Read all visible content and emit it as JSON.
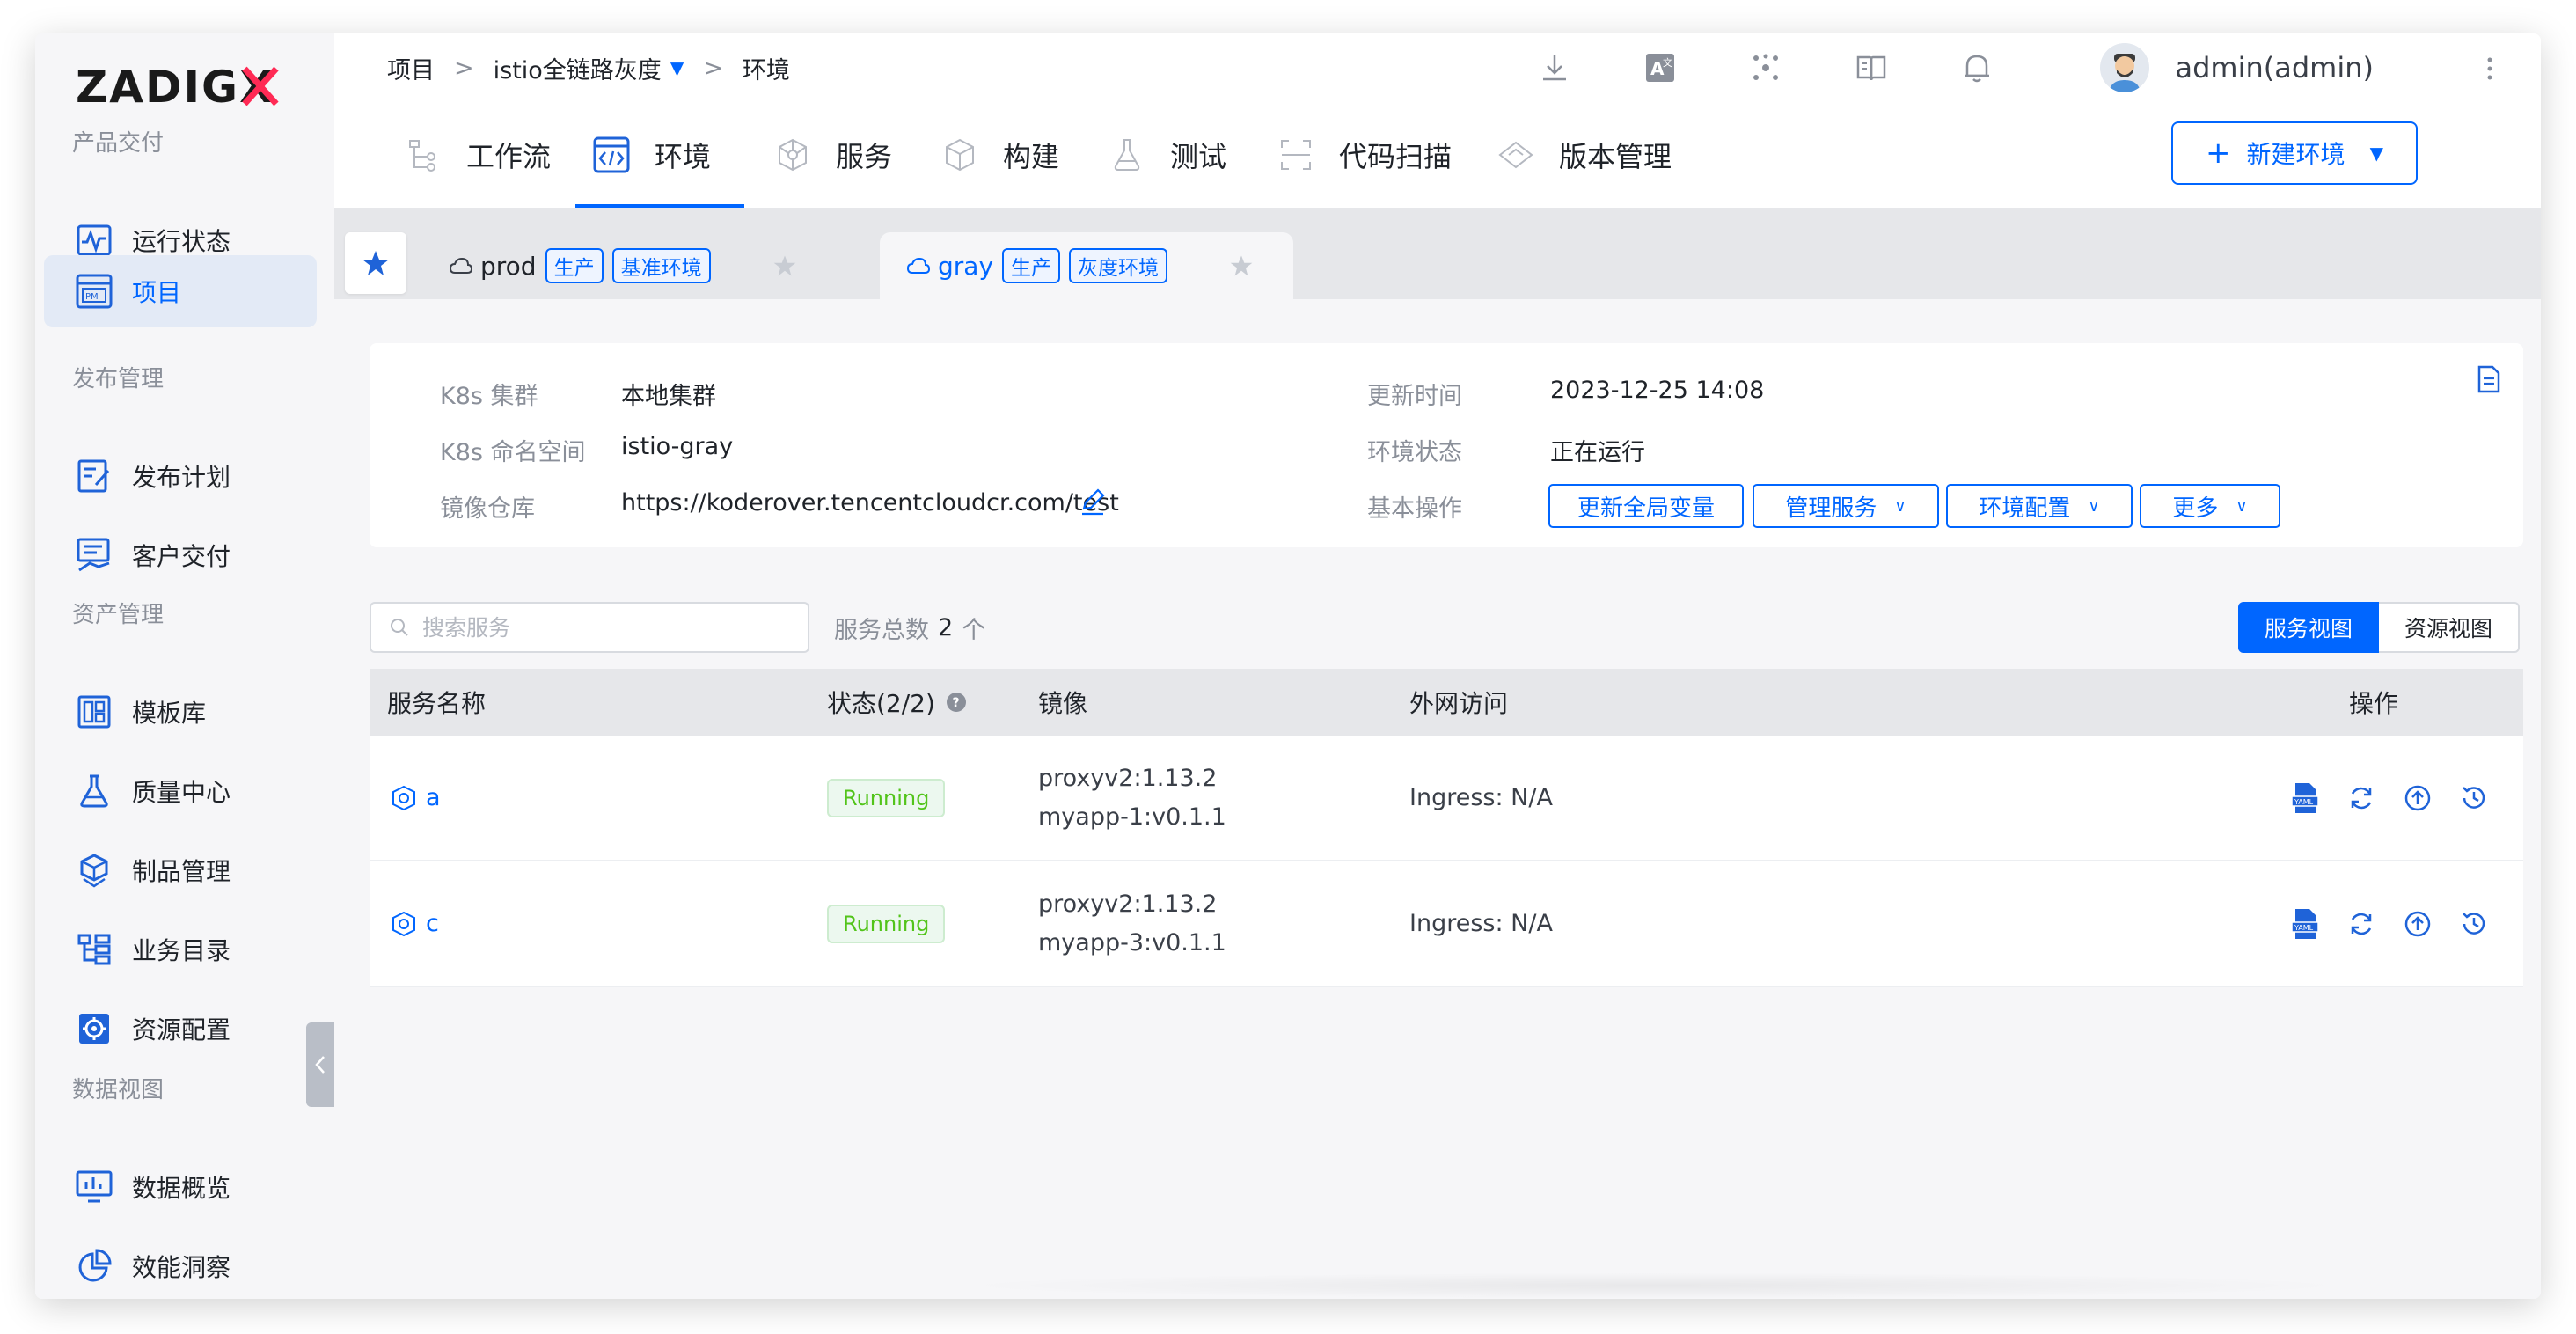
{
  "colors": {
    "accent": "#0066ff",
    "sidebar_bg": "#f6f6f8",
    "running_green": "#52c41a"
  },
  "sidebar": {
    "brand": "ZADIGX",
    "sections": [
      {
        "title": "产品交付",
        "items": [
          {
            "label": "运行状态",
            "icon": "pulse-icon"
          },
          {
            "label": "项目",
            "icon": "project-icon",
            "active": true
          }
        ]
      },
      {
        "title": "发布管理",
        "items": [
          {
            "label": "发布计划",
            "icon": "release-plan-icon"
          },
          {
            "label": "客户交付",
            "icon": "customer-delivery-icon"
          }
        ]
      },
      {
        "title": "资产管理",
        "items": [
          {
            "label": "模板库",
            "icon": "template-icon"
          },
          {
            "label": "质量中心",
            "icon": "flask-icon"
          },
          {
            "label": "制品管理",
            "icon": "artifact-icon"
          },
          {
            "label": "业务目录",
            "icon": "catalog-icon"
          },
          {
            "label": "资源配置",
            "icon": "gear-icon"
          }
        ]
      },
      {
        "title": "数据视图",
        "items": [
          {
            "label": "数据概览",
            "icon": "monitor-chart-icon"
          },
          {
            "label": "效能洞察",
            "icon": "pie-chart-icon"
          }
        ]
      }
    ]
  },
  "header": {
    "breadcrumbs": [
      "项目",
      "istio全链路灰度",
      "环境"
    ],
    "user": "admin(admin)"
  },
  "nav": {
    "items": [
      "工作流",
      "环境",
      "服务",
      "构建",
      "测试",
      "代码扫描",
      "版本管理"
    ],
    "active": "环境",
    "new_env_button": "新建环境"
  },
  "env_tabs": [
    {
      "name": "prod",
      "tags": [
        "生产",
        "基准环境"
      ]
    },
    {
      "name": "gray",
      "tags": [
        "生产",
        "灰度环境"
      ],
      "active": true
    }
  ],
  "env_info": {
    "k8s_cluster_label": "K8s 集群",
    "k8s_cluster": "本地集群",
    "namespace_label": "K8s 命名空间",
    "namespace": "istio-gray",
    "registry_label": "镜像仓库",
    "registry": "https://koderover.tencentcloudcr.com/test",
    "updated_label": "更新时间",
    "updated": "2023-12-25 14:08",
    "status_label": "环境状态",
    "status": "正在运行",
    "ops_label": "基本操作",
    "ops": [
      "更新全局变量",
      "管理服务",
      "环境配置",
      "更多"
    ]
  },
  "services": {
    "search_placeholder": "搜索服务",
    "total_label": "服务总数",
    "total": "2",
    "total_unit": "个",
    "view_service": "服务视图",
    "view_resource": "资源视图",
    "columns": [
      "服务名称",
      "状态(2/2)",
      "镜像",
      "外网访问",
      "操作"
    ],
    "rows": [
      {
        "name": "a",
        "status": "Running",
        "images": [
          "proxyv2:1.13.2",
          "myapp-1:v0.1.1"
        ],
        "access": "Ingress: N/A"
      },
      {
        "name": "c",
        "status": "Running",
        "images": [
          "proxyv2:1.13.2",
          "myapp-3:v0.1.1"
        ],
        "access": "Ingress: N/A"
      }
    ]
  }
}
